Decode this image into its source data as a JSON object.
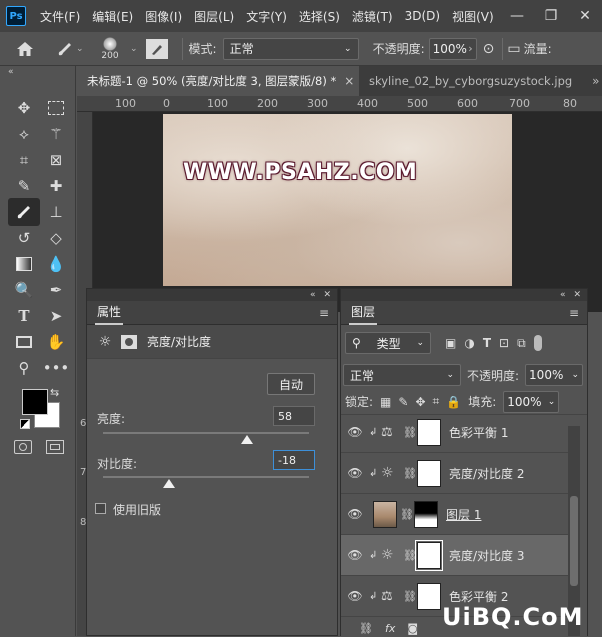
{
  "menubar": {
    "logo": "Ps",
    "items": [
      "文件(F)",
      "编辑(E)",
      "图像(I)",
      "图层(L)",
      "文字(Y)",
      "选择(S)",
      "滤镜(T)",
      "3D(D)",
      "视图(V)",
      "窗"
    ],
    "controls": [
      "—",
      "❐",
      "✕"
    ]
  },
  "options": {
    "brush_size": "200",
    "mode_label": "模式:",
    "mode_value": "正常",
    "opacity_label": "不透明度:",
    "opacity_value": "100%",
    "flow_label": "流量:"
  },
  "tabs": [
    {
      "label": "未标题-1 @ 50% (亮度/对比度 3, 图层蒙版/8) *",
      "close": "×"
    },
    {
      "label": "skyline_02_by_cyborgsuzystock.jpg"
    }
  ],
  "tabs_more": "»",
  "ruler_h": [
    "100",
    "0",
    "100",
    "200",
    "300",
    "400",
    "500",
    "600",
    "700",
    "80"
  ],
  "ruler_v": [
    "6",
    "7",
    "8"
  ],
  "watermark": "WWW.PSAHZ.COM",
  "props": {
    "title": "属性",
    "adj_name": "亮度/对比度",
    "auto_label": "自动",
    "brightness_label": "亮度:",
    "brightness_value": "58",
    "contrast_label": "对比度:",
    "contrast_value": "-18",
    "legacy_label": "使用旧版",
    "brightness_level": 0.58,
    "contrast_level": -0.18
  },
  "layers": {
    "title": "图层",
    "filter_label": "类型",
    "blend_mode": "正常",
    "opacity_label": "不透明度:",
    "opacity_value": "100%",
    "lock_label": "锁定:",
    "fill_label": "填充:",
    "fill_value": "100%",
    "rows": [
      {
        "name": "色彩平衡 1",
        "icon": "balance-icon"
      },
      {
        "name": "亮度/对比度 2",
        "icon": "sun-icon"
      },
      {
        "name": "图层 1",
        "icon": "image"
      },
      {
        "name": "亮度/对比度 3",
        "icon": "sun-icon"
      },
      {
        "name": "色彩平衡 2",
        "icon": "balance-icon"
      }
    ]
  },
  "footer_logo": "UiBQ.CoM",
  "colors": {
    "accent": "#31a8ff",
    "panel": "#535353",
    "dark": "#424242"
  }
}
